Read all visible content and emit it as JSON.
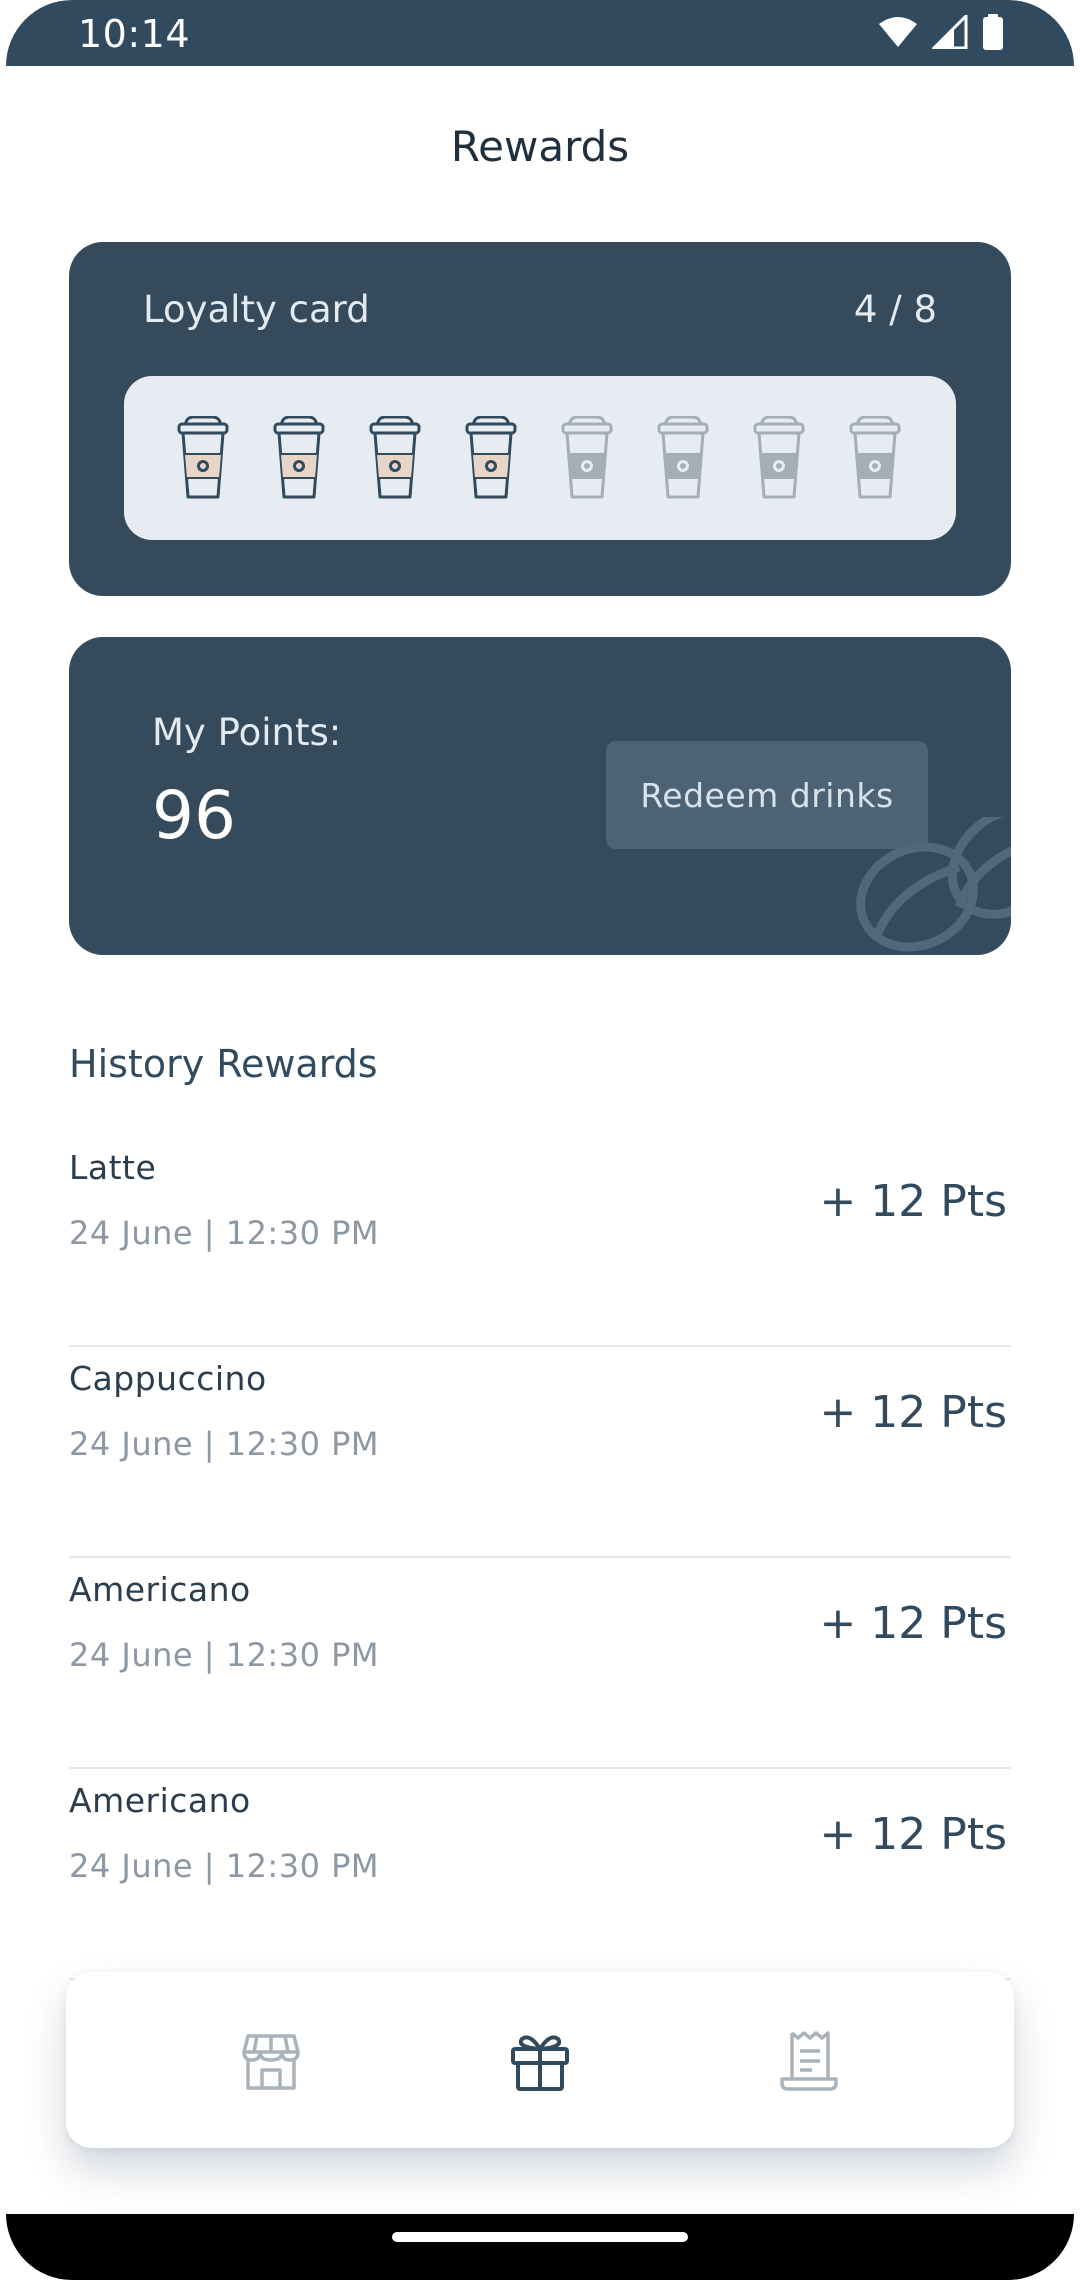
{
  "status_bar": {
    "time": "10:14"
  },
  "header": {
    "title": "Rewards"
  },
  "loyalty_card": {
    "title": "Loyalty card",
    "count_label": "4 / 8",
    "stamps_filled": 4,
    "stamps_total": 8
  },
  "points_card": {
    "label": "My Points:",
    "value": "96",
    "redeem_label": "Redeem drinks"
  },
  "history": {
    "title": "History Rewards",
    "items": [
      {
        "name": "Latte",
        "date": "24 June | 12:30 PM",
        "points": "+ 12 Pts"
      },
      {
        "name": "Cappuccino",
        "date": "24 June | 12:30 PM",
        "points": "+ 12 Pts"
      },
      {
        "name": "Americano",
        "date": "24 June | 12:30 PM",
        "points": "+ 12 Pts"
      },
      {
        "name": "Americano",
        "date": "24 June | 12:30 PM",
        "points": "+ 12 Pts"
      }
    ]
  },
  "bottom_nav": {
    "items": [
      {
        "icon": "store-icon",
        "active": false
      },
      {
        "icon": "gift-icon",
        "active": true
      },
      {
        "icon": "receipt-icon",
        "active": false
      }
    ]
  },
  "colors": {
    "primary": "#324a5e",
    "card": "#354b5c",
    "cup_active_sleeve": "#e7d6c8",
    "cup_inactive": "#a3aeb6",
    "muted_text": "#8c98a3"
  }
}
